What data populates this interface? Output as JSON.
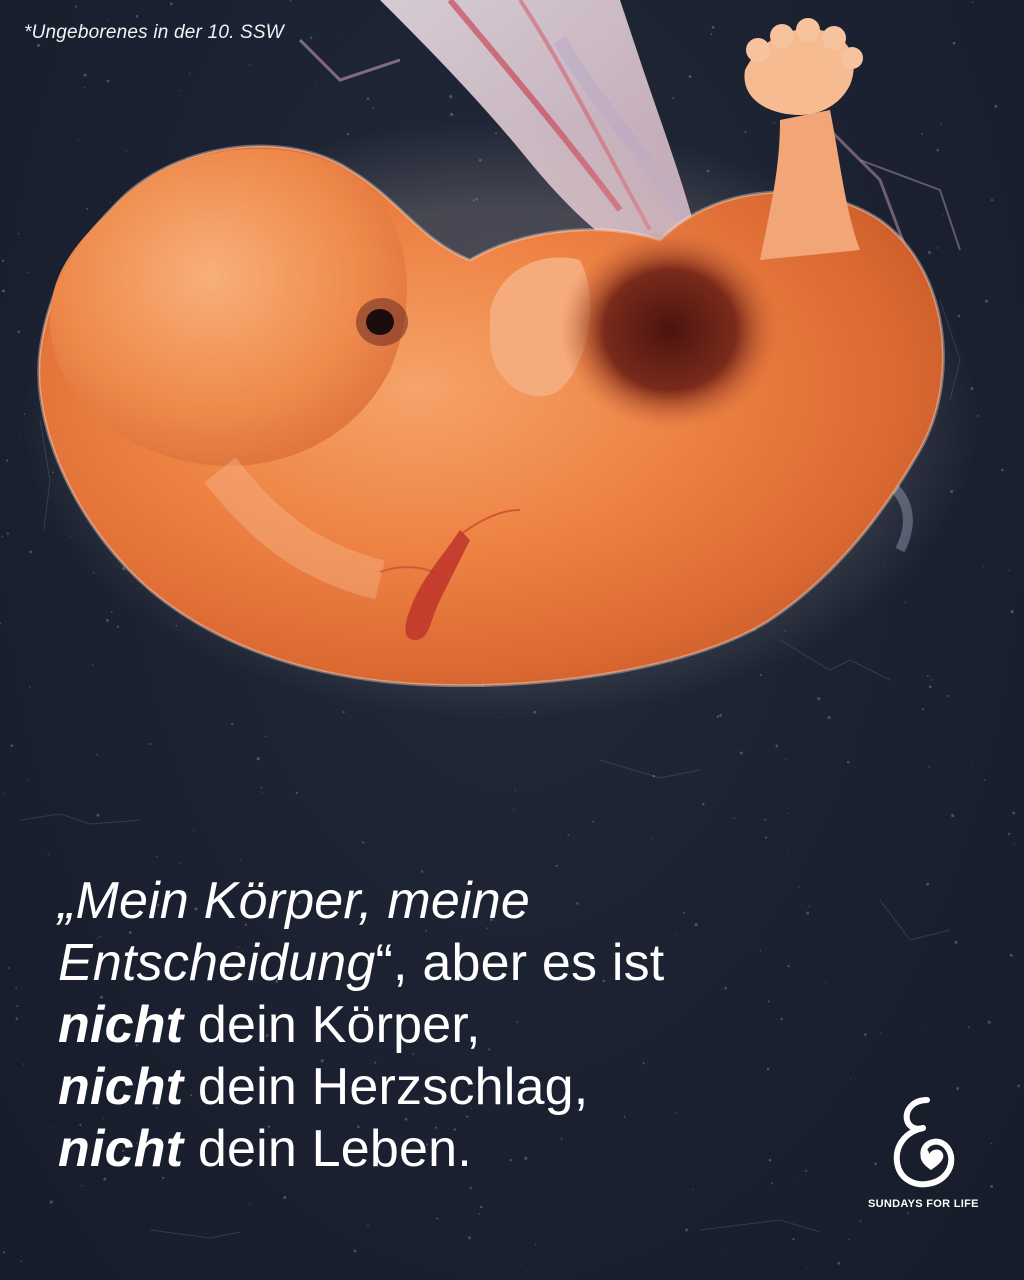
{
  "caption": "*Ungeborenes in der 10. SSW",
  "quote": {
    "line1_open": "„Mein Körper, meine",
    "line2_italic": "Entscheidung",
    "line2_rest": "“, aber es ist",
    "line3_bold": "nicht",
    "line3_rest": " dein Körper,",
    "line4_bold": "nicht",
    "line4_rest": " dein Herzschlag,",
    "line5_bold": "nicht",
    "line5_rest": " dein Leben."
  },
  "logo": {
    "name": "SUNDAYS FOR LIFE",
    "icon": "mother-child-icon"
  },
  "colors": {
    "background": "#1c2333",
    "text": "#ffffff",
    "embryo": "#f08a4b"
  }
}
